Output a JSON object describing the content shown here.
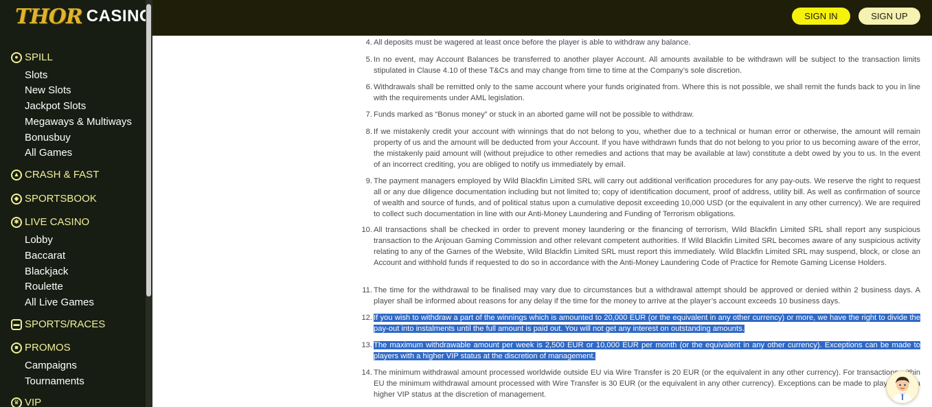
{
  "brand": {
    "logo_thor": "THOR",
    "logo_casino": "CASINO"
  },
  "header": {
    "signin_label": "SIGN IN",
    "signup_label": "SIGN UP"
  },
  "sidebar": {
    "spill": {
      "label": "SPILL",
      "items": [
        "Slots",
        "New Slots",
        "Jackpot Slots",
        "Megaways & Multiways",
        "Bonusbuy",
        "All Games"
      ]
    },
    "crash": {
      "label": "CRASH & FAST"
    },
    "sportsbook": {
      "label": "SPORTSBOOK"
    },
    "live": {
      "label": "LIVE CASINO",
      "items": [
        "Lobby",
        "Baccarat",
        "Blackjack",
        "Roulette",
        "All Live Games"
      ]
    },
    "races": {
      "label": "SPORTS/RACES"
    },
    "promos": {
      "label": "PROMOS",
      "items": [
        "Campaigns",
        "Tournaments"
      ]
    },
    "vip": {
      "label": "VIP"
    }
  },
  "terms": [
    {
      "num": "4.",
      "text": "All deposits must be wagered at least once before the player is able to withdraw any balance."
    },
    {
      "num": "5.",
      "text": "In no event, may Account Balances be transferred to another player Account. All amounts available to be withdrawn will be subject to the transaction limits stipulated in Clause 4.10 of these T&Cs and may change from time to time at the Company’s sole discretion."
    },
    {
      "num": "6.",
      "text": "Withdrawals shall be remitted only to the same account where your funds originated from. Where this is not possible, we shall remit the funds back to you in line with the requirements under AML legislation."
    },
    {
      "num": "7.",
      "text": "Funds marked as “Bonus money” or stuck in an aborted game will not be possible to withdraw."
    },
    {
      "num": "8.",
      "text": "If we mistakenly credit your account with winnings that do not belong to you, whether due to a technical or human error or otherwise, the amount will remain property of us and the amount will be deducted from your Account. If you have withdrawn funds that do not belong to you prior to us becoming aware of the error, the mistakenly paid amount will (without prejudice to other remedies and actions that may be available at law) constitute a debt owed by you to us. In the event of an incorrect crediting, you are obliged to notify us immediately by email."
    },
    {
      "num": "9.",
      "text": "The payment managers employed by Wild Blackfin Limited SRL will carry out additional verification procedures for any pay-outs. We reserve the right to request all or any due diligence documentation including but not limited to; copy of identification document, proof of address, utility bill. As well as confirmation of source of wealth and source of funds, and of political status upon a cumulative deposit exceeding 10,000 USD (or the equivalent in any other currency). We are required to collect such documentation in line with our Anti-Money Laundering and Funding of Terrorism obligations."
    },
    {
      "num": "10.",
      "text": "All transactions shall be checked in order to prevent money laundering or the financing of terrorism, Wild Blackfin Limited SRL shall report any suspicious transaction to the Anjouan Gaming Commission and other relevant competent authorities. If Wild Blackfin Limited SRL becomes aware of any suspicious activity relating to any of the Games of the Website, Wild Blackfin Limited SRL must report this immediately. Wild Blackfin Limited SRL may suspend, block, or close an Account and withhold funds if requested to do so in accordance with the Anti-Money Laundering Code of Practice for Remote Gaming License Holders."
    },
    {
      "num": "11.",
      "text": "The time for the withdrawal to be finalised may vary due to circumstances but a withdrawal attempt should be approved or denied within 2 business days. A player shall be informed about reasons for any delay if the time for the money to arrive at the player’s account exceeds 10 business days."
    },
    {
      "num": "12.",
      "text": "If you wish to withdraw a part of the winnings which is amounted to 20,000 EUR (or the equivalent in any other currency) or more, we have the right to divide the pay-out into instalments until the full amount is paid out. You will not get any interest on outstanding amounts."
    },
    {
      "num": "13.",
      "text": "The maximum withdrawable amount per week is 2,500 EUR or 10,000 EUR per month (or the equivalent in any other currency). Exceptions can be made to players with a higher VIP status at the discretion of management."
    },
    {
      "num": "14.",
      "text": "The minimum withdrawal amount processed worldwide outside EU via Wire Transfer is 20 EUR (or the equivalent in any other currency). For transactions within EU the minimum withdrawal amount processed with Wire Transfer is 30 EUR (or the equivalent in any other currency). Exceptions can be made to players with a higher VIP status at the discretion of management."
    }
  ]
}
